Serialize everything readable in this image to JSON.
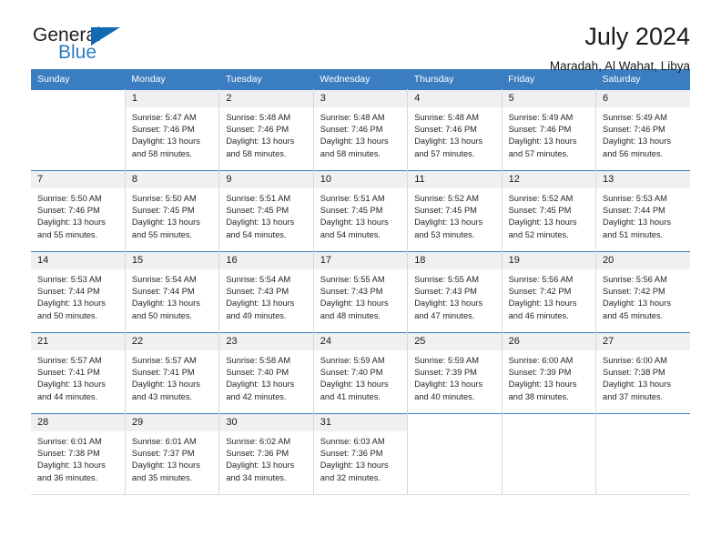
{
  "logo": {
    "word1": "General",
    "word2": "Blue",
    "triangle_color": "#1268b3",
    "blue_color": "#2b7dc2"
  },
  "header": {
    "title": "July 2024",
    "subtitle": "Maradah, Al Wahat, Libya"
  },
  "theme": {
    "header_bar": "#3b7dc1",
    "daynum_band": "#f0f0f0",
    "cell_border": "#d8d8d8"
  },
  "calendar": {
    "weekdays": [
      "Sunday",
      "Monday",
      "Tuesday",
      "Wednesday",
      "Thursday",
      "Friday",
      "Saturday"
    ],
    "weeks": [
      [
        {
          "day": "",
          "lines": []
        },
        {
          "day": "1",
          "lines": [
            "Sunrise: 5:47 AM",
            "Sunset: 7:46 PM",
            "Daylight: 13 hours",
            "and 58 minutes."
          ]
        },
        {
          "day": "2",
          "lines": [
            "Sunrise: 5:48 AM",
            "Sunset: 7:46 PM",
            "Daylight: 13 hours",
            "and 58 minutes."
          ]
        },
        {
          "day": "3",
          "lines": [
            "Sunrise: 5:48 AM",
            "Sunset: 7:46 PM",
            "Daylight: 13 hours",
            "and 58 minutes."
          ]
        },
        {
          "day": "4",
          "lines": [
            "Sunrise: 5:48 AM",
            "Sunset: 7:46 PM",
            "Daylight: 13 hours",
            "and 57 minutes."
          ]
        },
        {
          "day": "5",
          "lines": [
            "Sunrise: 5:49 AM",
            "Sunset: 7:46 PM",
            "Daylight: 13 hours",
            "and 57 minutes."
          ]
        },
        {
          "day": "6",
          "lines": [
            "Sunrise: 5:49 AM",
            "Sunset: 7:46 PM",
            "Daylight: 13 hours",
            "and 56 minutes."
          ]
        }
      ],
      [
        {
          "day": "7",
          "lines": [
            "Sunrise: 5:50 AM",
            "Sunset: 7:46 PM",
            "Daylight: 13 hours",
            "and 55 minutes."
          ]
        },
        {
          "day": "8",
          "lines": [
            "Sunrise: 5:50 AM",
            "Sunset: 7:45 PM",
            "Daylight: 13 hours",
            "and 55 minutes."
          ]
        },
        {
          "day": "9",
          "lines": [
            "Sunrise: 5:51 AM",
            "Sunset: 7:45 PM",
            "Daylight: 13 hours",
            "and 54 minutes."
          ]
        },
        {
          "day": "10",
          "lines": [
            "Sunrise: 5:51 AM",
            "Sunset: 7:45 PM",
            "Daylight: 13 hours",
            "and 54 minutes."
          ]
        },
        {
          "day": "11",
          "lines": [
            "Sunrise: 5:52 AM",
            "Sunset: 7:45 PM",
            "Daylight: 13 hours",
            "and 53 minutes."
          ]
        },
        {
          "day": "12",
          "lines": [
            "Sunrise: 5:52 AM",
            "Sunset: 7:45 PM",
            "Daylight: 13 hours",
            "and 52 minutes."
          ]
        },
        {
          "day": "13",
          "lines": [
            "Sunrise: 5:53 AM",
            "Sunset: 7:44 PM",
            "Daylight: 13 hours",
            "and 51 minutes."
          ]
        }
      ],
      [
        {
          "day": "14",
          "lines": [
            "Sunrise: 5:53 AM",
            "Sunset: 7:44 PM",
            "Daylight: 13 hours",
            "and 50 minutes."
          ]
        },
        {
          "day": "15",
          "lines": [
            "Sunrise: 5:54 AM",
            "Sunset: 7:44 PM",
            "Daylight: 13 hours",
            "and 50 minutes."
          ]
        },
        {
          "day": "16",
          "lines": [
            "Sunrise: 5:54 AM",
            "Sunset: 7:43 PM",
            "Daylight: 13 hours",
            "and 49 minutes."
          ]
        },
        {
          "day": "17",
          "lines": [
            "Sunrise: 5:55 AM",
            "Sunset: 7:43 PM",
            "Daylight: 13 hours",
            "and 48 minutes."
          ]
        },
        {
          "day": "18",
          "lines": [
            "Sunrise: 5:55 AM",
            "Sunset: 7:43 PM",
            "Daylight: 13 hours",
            "and 47 minutes."
          ]
        },
        {
          "day": "19",
          "lines": [
            "Sunrise: 5:56 AM",
            "Sunset: 7:42 PM",
            "Daylight: 13 hours",
            "and 46 minutes."
          ]
        },
        {
          "day": "20",
          "lines": [
            "Sunrise: 5:56 AM",
            "Sunset: 7:42 PM",
            "Daylight: 13 hours",
            "and 45 minutes."
          ]
        }
      ],
      [
        {
          "day": "21",
          "lines": [
            "Sunrise: 5:57 AM",
            "Sunset: 7:41 PM",
            "Daylight: 13 hours",
            "and 44 minutes."
          ]
        },
        {
          "day": "22",
          "lines": [
            "Sunrise: 5:57 AM",
            "Sunset: 7:41 PM",
            "Daylight: 13 hours",
            "and 43 minutes."
          ]
        },
        {
          "day": "23",
          "lines": [
            "Sunrise: 5:58 AM",
            "Sunset: 7:40 PM",
            "Daylight: 13 hours",
            "and 42 minutes."
          ]
        },
        {
          "day": "24",
          "lines": [
            "Sunrise: 5:59 AM",
            "Sunset: 7:40 PM",
            "Daylight: 13 hours",
            "and 41 minutes."
          ]
        },
        {
          "day": "25",
          "lines": [
            "Sunrise: 5:59 AM",
            "Sunset: 7:39 PM",
            "Daylight: 13 hours",
            "and 40 minutes."
          ]
        },
        {
          "day": "26",
          "lines": [
            "Sunrise: 6:00 AM",
            "Sunset: 7:39 PM",
            "Daylight: 13 hours",
            "and 38 minutes."
          ]
        },
        {
          "day": "27",
          "lines": [
            "Sunrise: 6:00 AM",
            "Sunset: 7:38 PM",
            "Daylight: 13 hours",
            "and 37 minutes."
          ]
        }
      ],
      [
        {
          "day": "28",
          "lines": [
            "Sunrise: 6:01 AM",
            "Sunset: 7:38 PM",
            "Daylight: 13 hours",
            "and 36 minutes."
          ]
        },
        {
          "day": "29",
          "lines": [
            "Sunrise: 6:01 AM",
            "Sunset: 7:37 PM",
            "Daylight: 13 hours",
            "and 35 minutes."
          ]
        },
        {
          "day": "30",
          "lines": [
            "Sunrise: 6:02 AM",
            "Sunset: 7:36 PM",
            "Daylight: 13 hours",
            "and 34 minutes."
          ]
        },
        {
          "day": "31",
          "lines": [
            "Sunrise: 6:03 AM",
            "Sunset: 7:36 PM",
            "Daylight: 13 hours",
            "and 32 minutes."
          ]
        },
        {
          "day": "",
          "lines": []
        },
        {
          "day": "",
          "lines": []
        },
        {
          "day": "",
          "lines": []
        }
      ]
    ]
  }
}
